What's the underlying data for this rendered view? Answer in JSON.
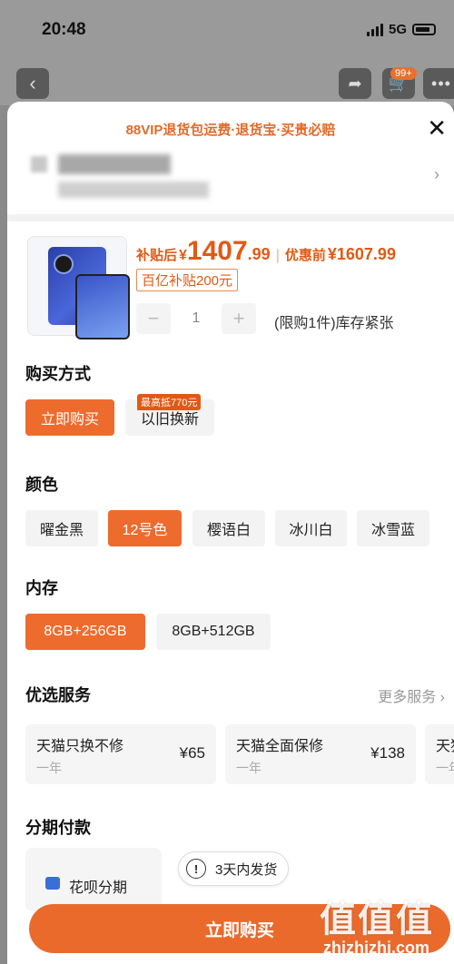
{
  "status_bar": {
    "time": "20:48",
    "network": "5G"
  },
  "header": {
    "cart_badge": "99+"
  },
  "sheet": {
    "promo": "88VIP退货包运费·退货宝·买贵必赔"
  },
  "product": {
    "price_label": "补贴后",
    "currency": "¥",
    "price_int": "1407",
    "price_dec": ".99",
    "sep": "|",
    "pre_label": "优惠前",
    "pre_price": "¥1607.99",
    "subsidy_tag": "百亿补贴200元",
    "quantity": "1",
    "stock_note": "(限购1件)库存紧张"
  },
  "purchase_method": {
    "title": "购买方式",
    "options": [
      "立即购买",
      "以旧换新"
    ],
    "badge": "最高抵770元"
  },
  "color": {
    "title": "颜色",
    "options": [
      "曜金黑",
      "12号色",
      "樱语白",
      "冰川白",
      "冰雪蓝"
    ]
  },
  "storage": {
    "title": "内存",
    "options": [
      "8GB+256GB",
      "8GB+512GB"
    ]
  },
  "services": {
    "title": "优选服务",
    "more": "更多服务 ›",
    "items": [
      {
        "name": "天猫只换不修",
        "term": "一年",
        "price": "¥65"
      },
      {
        "name": "天猫全面保修",
        "term": "一年",
        "price": "¥138"
      },
      {
        "name": "天猫",
        "term": "一年",
        "price": ""
      }
    ]
  },
  "installment": {
    "title": "分期付款",
    "option": "花呗分期"
  },
  "shipping_tip": "3天内发货",
  "buy_button": "立即购买",
  "watermark": {
    "top": "值值值",
    "bottom": "zhizhizhi.com"
  }
}
